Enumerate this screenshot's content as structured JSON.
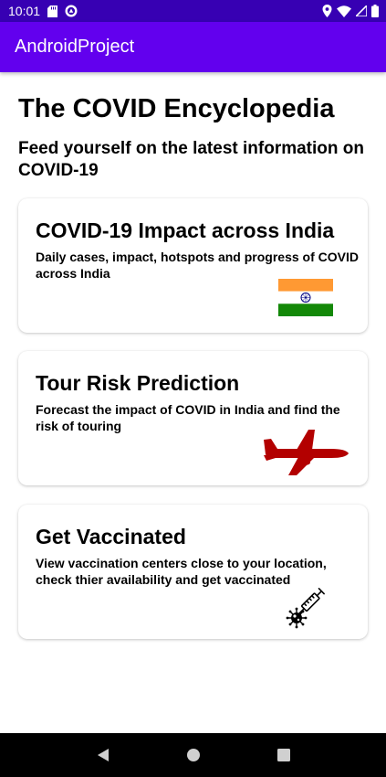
{
  "status_bar": {
    "time": "10:01",
    "left_icons": [
      "sd-card-icon",
      "data-saver-icon"
    ],
    "right_icons": [
      "location-icon",
      "wifi-icon",
      "signal-icon",
      "battery-icon"
    ]
  },
  "app_bar": {
    "title": "AndroidProject"
  },
  "page": {
    "title": "The COVID Encyclopedia",
    "subtitle": "Feed yourself on the latest information on COVID-19"
  },
  "cards": [
    {
      "title": "COVID-19 Impact across India",
      "description": "Daily cases, impact, hotspots and progress of COVID across India",
      "image": "india-flag-icon"
    },
    {
      "title": "Tour Risk Prediction",
      "description": "Forecast the impact of COVID in India and find the risk of touring",
      "image": "airplane-icon"
    },
    {
      "title": "Get Vaccinated",
      "description": "View vaccination centers close to your location, check thier availability and get vaccinated",
      "image": "vaccine-syringe-icon"
    }
  ],
  "nav_bar": {
    "buttons": [
      "back-icon",
      "home-icon",
      "recents-icon"
    ]
  },
  "colors": {
    "status_bar": "#3700b3",
    "app_bar": "#6200ee",
    "flag_saffron": "#ff9933",
    "flag_green": "#138808",
    "flag_chakra": "#000080",
    "airplane": "#b30000"
  }
}
